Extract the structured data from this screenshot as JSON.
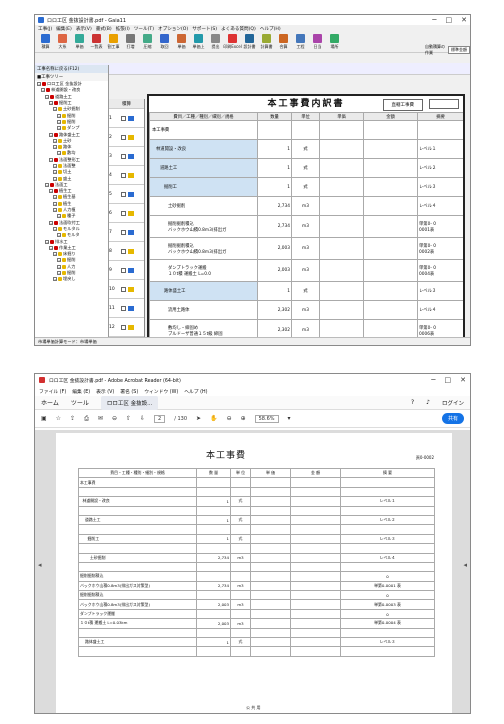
{
  "top_window": {
    "title": "ロロ工区 金抜設計書.pdf - Gaia11",
    "menu": [
      "工事(J)",
      "編集(E)",
      "表示(V)",
      "書式(B)",
      "拡張(I)",
      "ツール(T)",
      "オプション(O)",
      "サポート(S)",
      "よくある質問(Q)",
      "ヘルプ(H)"
    ],
    "toolbar": [
      "積算",
      "大系",
      "単価",
      "一覧表",
      "割工事",
      "打増",
      "圧縮",
      "取回",
      "単価",
      "単価上",
      "提出",
      "印刷Excel",
      "設計書",
      "計算書",
      "合算",
      "工程",
      "日当",
      "場所"
    ],
    "side_labels": [
      "自動積算の作業",
      "標準金額"
    ],
    "tree_header": "工事名称に戻る(F12)",
    "tree_sub": "■工事ツリー",
    "tree": [
      "ロロ工区 金抜設計",
      "林道開設・改良",
      "道路土工",
      "掘削工",
      "土砂掘削",
      "掘削",
      "掘削",
      "ダンプ",
      "路体盛土工",
      "土砂",
      "路体",
      "敷均",
      "法面整形工",
      "法面整",
      "切土",
      "盛土",
      "法面工",
      "植生工",
      "植生基",
      "植生",
      "人力植",
      "種子",
      "法面吹付工",
      "モルタル",
      "モルタ",
      "排水工",
      "作業土工",
      "床掘り",
      "掘削",
      "人力",
      "掘削",
      "埋戻し"
    ],
    "grid_header": "積算",
    "grid_rows": [
      "1",
      "2",
      "3",
      "4",
      "5",
      "6",
      "7",
      "8",
      "9",
      "10",
      "11",
      "12"
    ],
    "doc_title": "本工事費内訳書",
    "doc_kind": "直轄工事費",
    "columns": [
      "費目／工種／種別／細別／規格",
      "数量",
      "単位",
      "単価",
      "金額",
      "摘要"
    ],
    "rows": [
      {
        "name": "本工事費",
        "qty": "",
        "unit": "",
        "note": "",
        "lvl": 0
      },
      {
        "name": "林道開設・改良",
        "qty": "1",
        "unit": "式",
        "note": "レベル１",
        "lvl": 1
      },
      {
        "name": "道路土工",
        "qty": "1",
        "unit": "式",
        "note": "レベル２",
        "lvl": 2
      },
      {
        "name": "掘削工",
        "qty": "1",
        "unit": "式",
        "note": "レベル３",
        "lvl": 3
      },
      {
        "name": "土砂掘削",
        "qty": "2,734",
        "unit": "m3",
        "note": "レベル４",
        "lvl": 4
      },
      {
        "name": "掘削掘削積込",
        "name2": "バックホウ山積0.8m3(排出ガ",
        "qty": "2,734",
        "unit": "m3",
        "note": "単第0-  0",
        "note2": "0001表",
        "lvl": 5
      },
      {
        "name": "掘削掘削積込",
        "name2": "バックホウ山積0.8m3(排出ガ",
        "qty": "2,003",
        "unit": "m3",
        "note": "単第0-  0",
        "note2": "0002表",
        "lvl": 5
      },
      {
        "name": "ダンプトラック運搬",
        "name2": "１０t積 運搬土 L=0.0",
        "qty": "2,003",
        "unit": "m3",
        "note": "単第0-  0",
        "note2": "0004表",
        "lvl": 5
      },
      {
        "name": "路体盛土工",
        "qty": "1",
        "unit": "式",
        "note": "レベル３",
        "lvl": 3
      },
      {
        "name": "流用土路体",
        "qty": "2,302",
        "unit": "m3",
        "note": "レベル４",
        "lvl": 4
      },
      {
        "name": "敷均し・締固め",
        "name2": "ブルドーザ普通１５t級 締固",
        "qty": "2,302",
        "unit": "m3",
        "note": "単第0-  0",
        "note2": "0006表",
        "lvl": 5
      },
      {
        "name": "路床盛土工",
        "qty": "1",
        "unit": "式",
        "note": "レベル３",
        "lvl": 3
      }
    ],
    "status": "市場単価計算モード：市場単価"
  },
  "bottom_window": {
    "title": "ロロ工区 金抜設計書.pdf - Adobe Acrobat Reader (64-bit)",
    "menu": [
      "ファイル (F)",
      "編集 (E)",
      "表示 (V)",
      "署名 (S)",
      "ウィンドウ (W)",
      "ヘルプ (H)"
    ],
    "tabs": [
      "ホーム",
      "ツール"
    ],
    "doc_tab": "ロロ工区 金抜設...",
    "page_current": "2",
    "page_total": "/ 130",
    "zoom": "58.6%",
    "login": "ログイン",
    "share": "共有",
    "page_title": "本工事費",
    "page_ref": "頁0-0002",
    "page_columns": [
      "費目・工種・種別・細別・規格",
      "数 量",
      "単 位",
      "単 価",
      "金 額",
      "摘 要"
    ],
    "page_rows": [
      {
        "name": "本工事費",
        "qty": "",
        "unit": "",
        "note": ""
      },
      {
        "name": "",
        "qty": "",
        "unit": "",
        "note": ""
      },
      {
        "name": "  林道開設・改良",
        "qty": "1",
        "unit": "式",
        "note": "レベル１"
      },
      {
        "name": "",
        "qty": "",
        "unit": "",
        "note": ""
      },
      {
        "name": "    道路土工",
        "qty": "1",
        "unit": "式",
        "note": "レベル２"
      },
      {
        "name": "",
        "qty": "",
        "unit": "",
        "note": ""
      },
      {
        "name": "      掘削工",
        "qty": "1",
        "unit": "式",
        "note": "レベル３"
      },
      {
        "name": "",
        "qty": "",
        "unit": "",
        "note": ""
      },
      {
        "name": "        土砂掘削",
        "qty": "2,734",
        "unit": "m3",
        "note": "レベル４"
      },
      {
        "name": "",
        "qty": "",
        "unit": "",
        "note": ""
      },
      {
        "name": "掘削掘削積込",
        "qty": "",
        "unit": "",
        "note": "0"
      },
      {
        "name": "バックホウ山積0.8m3(排出ガス対策型)",
        "qty": "2,734",
        "unit": "m3",
        "note": "単第0-0001 表"
      },
      {
        "name": "掘削掘削積込",
        "qty": "",
        "unit": "",
        "note": "0"
      },
      {
        "name": "バックホウ山積0.8m3(排出ガス対策型)",
        "qty": "2,003",
        "unit": "m3",
        "note": "単第0-0003 表"
      },
      {
        "name": "ダンプトラック運搬",
        "qty": "",
        "unit": "",
        "note": "0"
      },
      {
        "name": "１０t積 運搬土 L=0.03km",
        "qty": "2,003",
        "unit": "m3",
        "note": "単第0-0004 表"
      },
      {
        "name": "",
        "qty": "",
        "unit": "",
        "note": ""
      },
      {
        "name": "    路体盛土工",
        "qty": "1",
        "unit": "式",
        "note": "レベル３"
      },
      {
        "name": "",
        "qty": "",
        "unit": "",
        "note": ""
      }
    ],
    "footer": "公 共 用"
  }
}
